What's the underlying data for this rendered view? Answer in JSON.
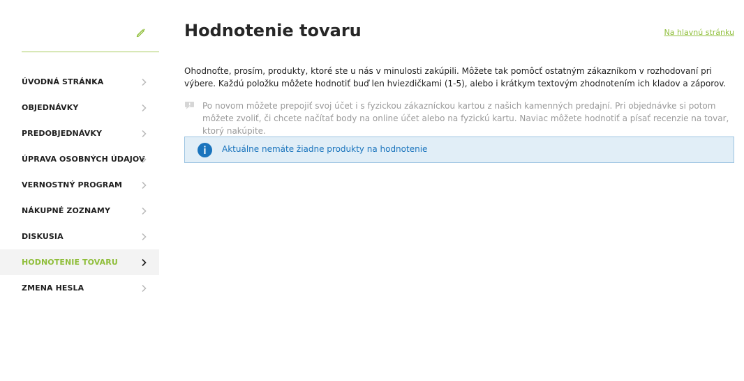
{
  "sidebar": {
    "edit_icon": "pencil-icon",
    "items": [
      {
        "label": "ÚVODNÁ STRÁNKA",
        "active": false
      },
      {
        "label": "OBJEDNÁVKY",
        "active": false
      },
      {
        "label": "PREDOBJEDNÁVKY",
        "active": false
      },
      {
        "label": "ÚPRAVA OSOBNÝCH ÚDAJOV",
        "active": false
      },
      {
        "label": "VERNOSTNÝ PROGRAM",
        "active": false
      },
      {
        "label": "NÁKUPNÉ ZOZNAMY",
        "active": false
      },
      {
        "label": "DISKUSIA",
        "active": false
      },
      {
        "label": "HODNOTENIE TOVARU",
        "active": true
      },
      {
        "label": "ZMENA HESLA",
        "active": false
      }
    ]
  },
  "main": {
    "title": "Hodnotenie tovaru",
    "home_link": "Na hlavnú stránku",
    "intro": "Ohodnoťte, prosím, produkty, ktoré ste u nás v minulosti zakúpili. Môžete tak pomôcť ostatným zákazníkom v rozhodovaní pri výbere. Každú položku môžete hodnotiť buď len hviezdičkami (1-5), alebo i krátkym textovým zhodnotením ich kladov a záporov.",
    "notice": "Po novom môžete prepojiť svoj účet i s fyzickou zákazníckou kartou z našich kamenných predajní. Pri objednávke si potom môžete zvoliť, či chcete načítať body na online účet alebo na fyzickú kartu. Naviac môžete hodnotiť a písať recenzie na tovar, ktorý nakúpite.",
    "alert": "Aktuálne nemáte žiadne produkty na hodnotenie"
  },
  "colors": {
    "accent": "#8fbe3a",
    "info": "#1a74bd",
    "info_bg": "#e1eef7"
  }
}
